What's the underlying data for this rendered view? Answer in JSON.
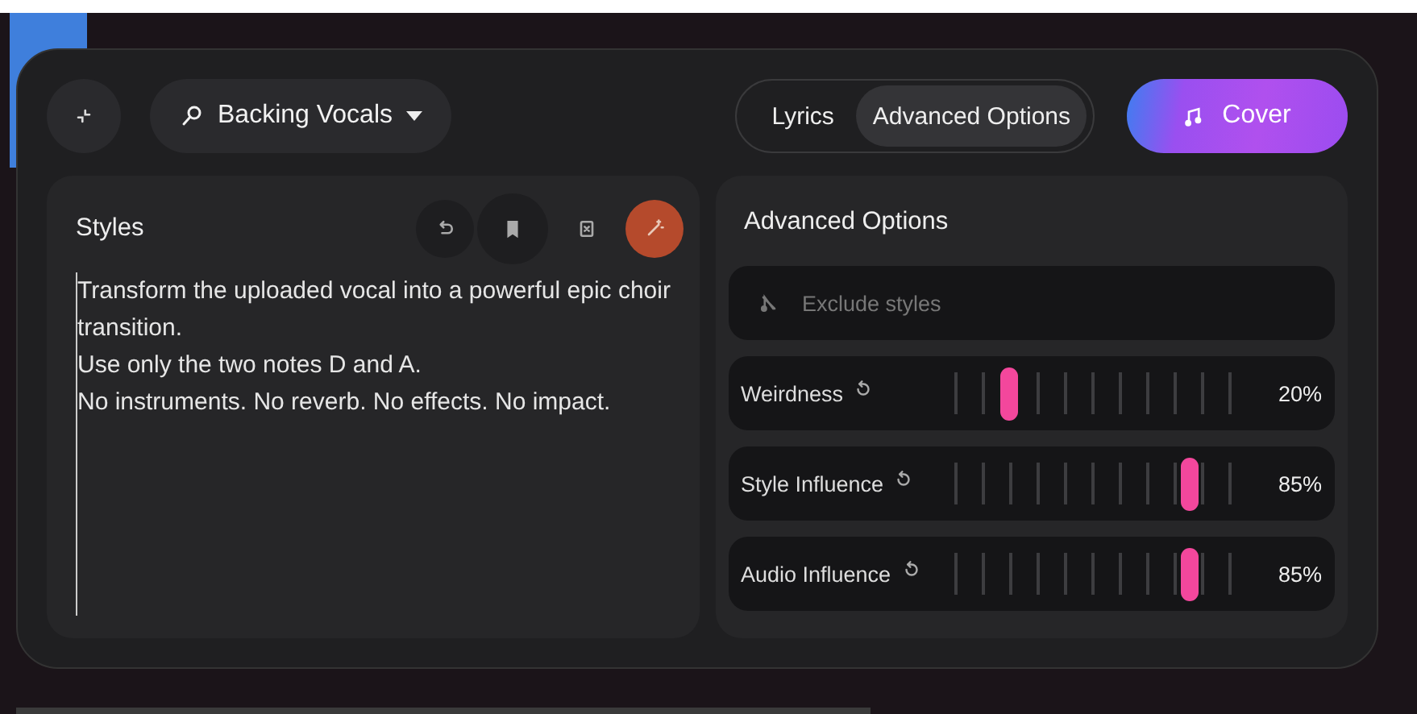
{
  "header": {
    "voice_selector": "Backing Vocals",
    "tabs": [
      {
        "label": "Lyrics",
        "selected": false
      },
      {
        "label": "Advanced Options",
        "selected": true
      }
    ],
    "cover_button": "Cover"
  },
  "styles": {
    "title": "Styles",
    "value": "Transform the uploaded vocal into a powerful epic choir transition.\nUse only the two notes D and A.\nNo instruments. No reverb. No effects. No impact."
  },
  "advanced": {
    "title": "Advanced Options",
    "exclude": {
      "placeholder": "Exclude styles"
    },
    "sliders": [
      {
        "name": "Weirdness",
        "level": 0.2,
        "reading": "20%"
      },
      {
        "name": "Style Influence",
        "level": 0.85,
        "reading": "85%"
      },
      {
        "name": "Audio Influence",
        "level": 0.85,
        "reading": "85%"
      }
    ]
  }
}
